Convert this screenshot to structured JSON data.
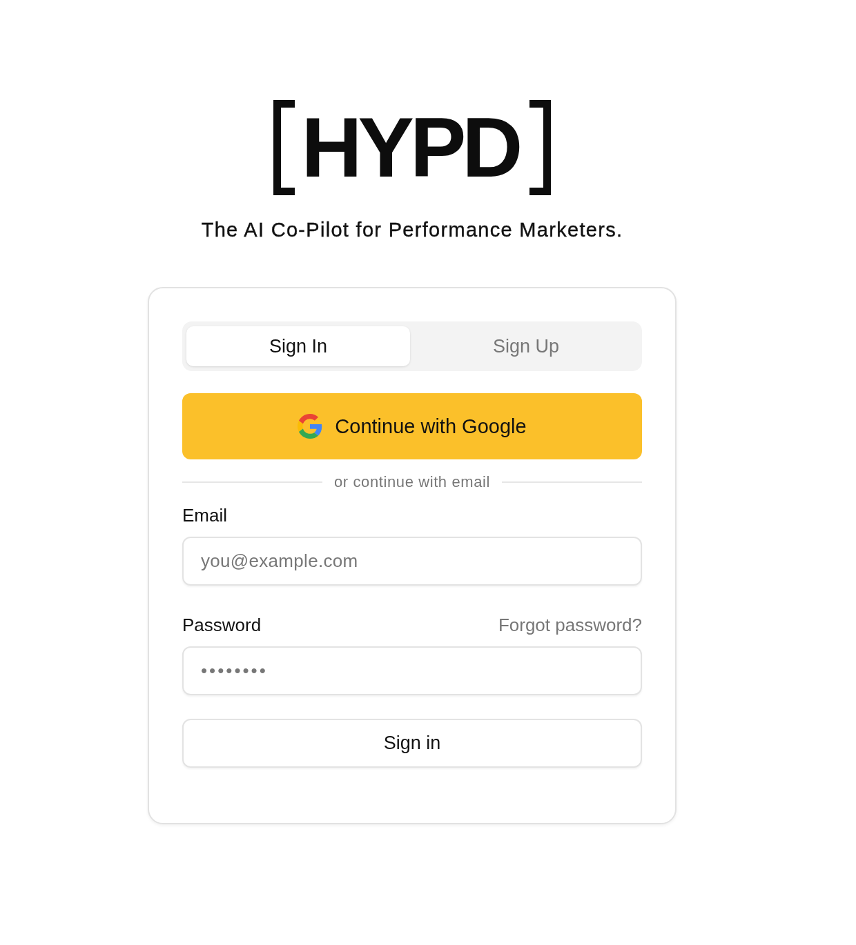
{
  "logo": {
    "text": "HYPD"
  },
  "tagline": "The AI Co-Pilot for Performance Marketers.",
  "tabs": [
    {
      "label": "Sign In",
      "selected": true
    },
    {
      "label": "Sign Up",
      "selected": false
    }
  ],
  "google_button": {
    "label": "Continue with Google"
  },
  "divider": "or continue with email",
  "fields": [
    {
      "kind": "email",
      "label": "Email",
      "placeholder": "you@example.com"
    },
    {
      "kind": "password",
      "label": "Password",
      "link": "Forgot password?",
      "placeholder": "••••••••"
    }
  ],
  "submit_button": "Sign in"
}
